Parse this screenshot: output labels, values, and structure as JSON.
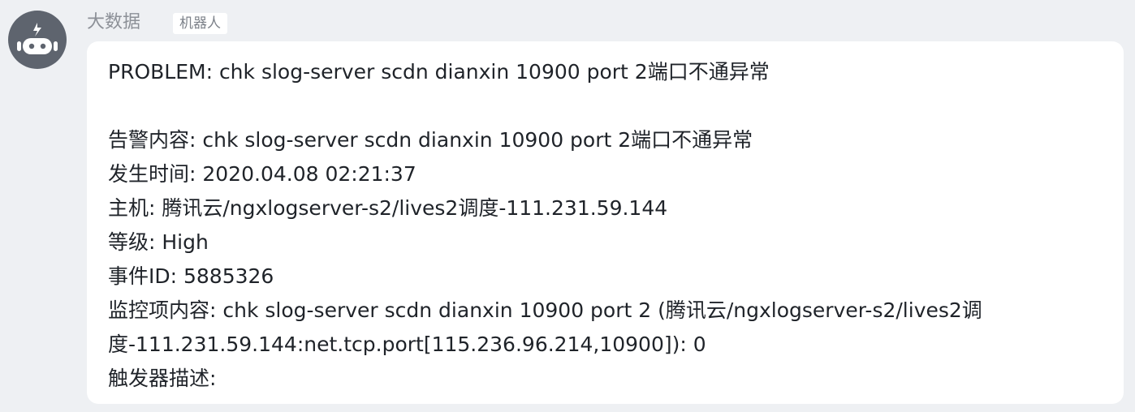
{
  "sender": {
    "name": "大数据",
    "badge": "机器人"
  },
  "avatar": {
    "icon": "robot-icon",
    "background": "#5e646e",
    "foreground": "#ffffff"
  },
  "message": {
    "lines": [
      "PROBLEM: chk slog-server scdn dianxin 10900 port 2端口不通异常",
      "",
      "告警内容: chk slog-server scdn dianxin 10900 port 2端口不通异常",
      "发生时间: 2020.04.08 02:21:37",
      "主机: 腾讯云/ngxlogserver-s2/lives2调度-111.231.59.144",
      "等级: High",
      "事件ID: 5885326",
      "监控项内容: chk slog-server scdn dianxin 10900 port 2 (腾讯云/ngxlogserver-s2/lives2调",
      "度-111.231.59.144:net.tcp.port[115.236.96.214,10900]): 0",
      "触发器描述:"
    ]
  },
  "colors": {
    "page_background": "#eef0f3",
    "bubble_background": "#ffffff",
    "text": "#1f2329",
    "muted_text": "#8c9097"
  }
}
